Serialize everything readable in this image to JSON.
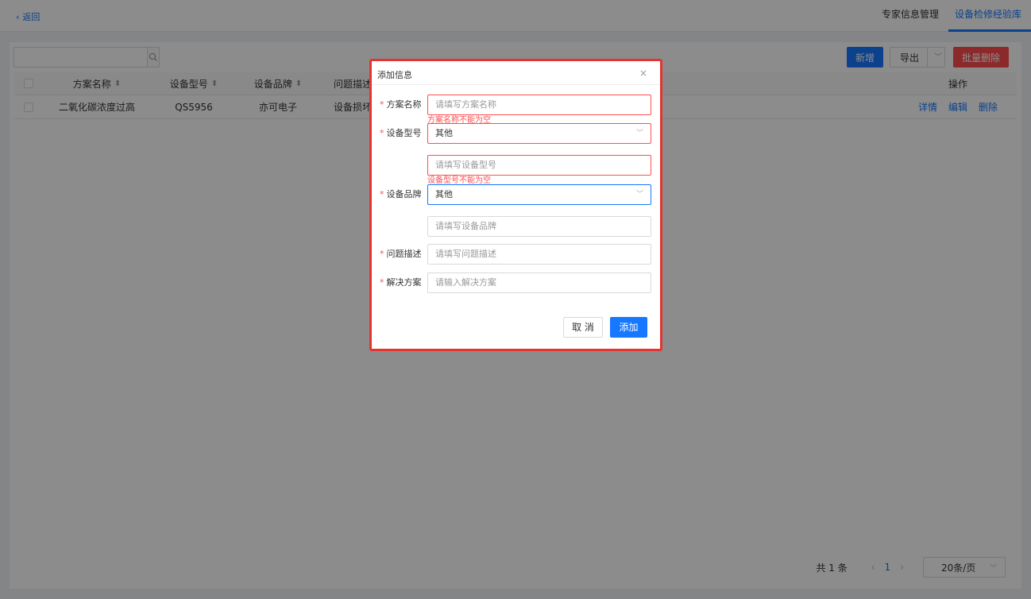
{
  "topbar": {
    "back_label": "返回",
    "tabs": [
      "专家信息管理",
      "设备检修经验库"
    ]
  },
  "toolbar": {
    "search_placeholder": "",
    "add_label": "新增",
    "export_label": "导出",
    "batch_delete_label": "批量删除"
  },
  "table": {
    "headers": [
      "方案名称",
      "设备型号",
      "设备品牌",
      "问题描述",
      "操作"
    ],
    "rows": [
      {
        "name": "二氧化碳浓度过高",
        "model": "QS5956",
        "brand": "亦可电子",
        "desc": "设备损坏",
        "actions": [
          "详情",
          "编辑",
          "删除"
        ]
      }
    ]
  },
  "pagination": {
    "total": "共 1 条",
    "current_page": "1",
    "page_size": "20条/页"
  },
  "modal": {
    "title": "添加信息",
    "close": "×",
    "fields": {
      "scheme_name": {
        "label": "方案名称",
        "placeholder": "请填写方案名称",
        "error": "方案名称不能为空"
      },
      "model": {
        "label": "设备型号",
        "value": "其他",
        "placeholder": "请填写设备型号",
        "error": "设备型号不能为空"
      },
      "brand": {
        "label": "设备品牌",
        "value": "其他",
        "placeholder": "请填写设备品牌"
      },
      "problem": {
        "label": "问题描述",
        "placeholder": "请填写问题描述"
      },
      "solution": {
        "label": "解决方案",
        "placeholder": "请输入解决方案"
      }
    },
    "cancel_label": "取 消",
    "submit_label": "添加"
  },
  "colors": {
    "primary": "#1677ff",
    "danger": "#ff4d4f",
    "highlight_border": "#e5342f"
  }
}
